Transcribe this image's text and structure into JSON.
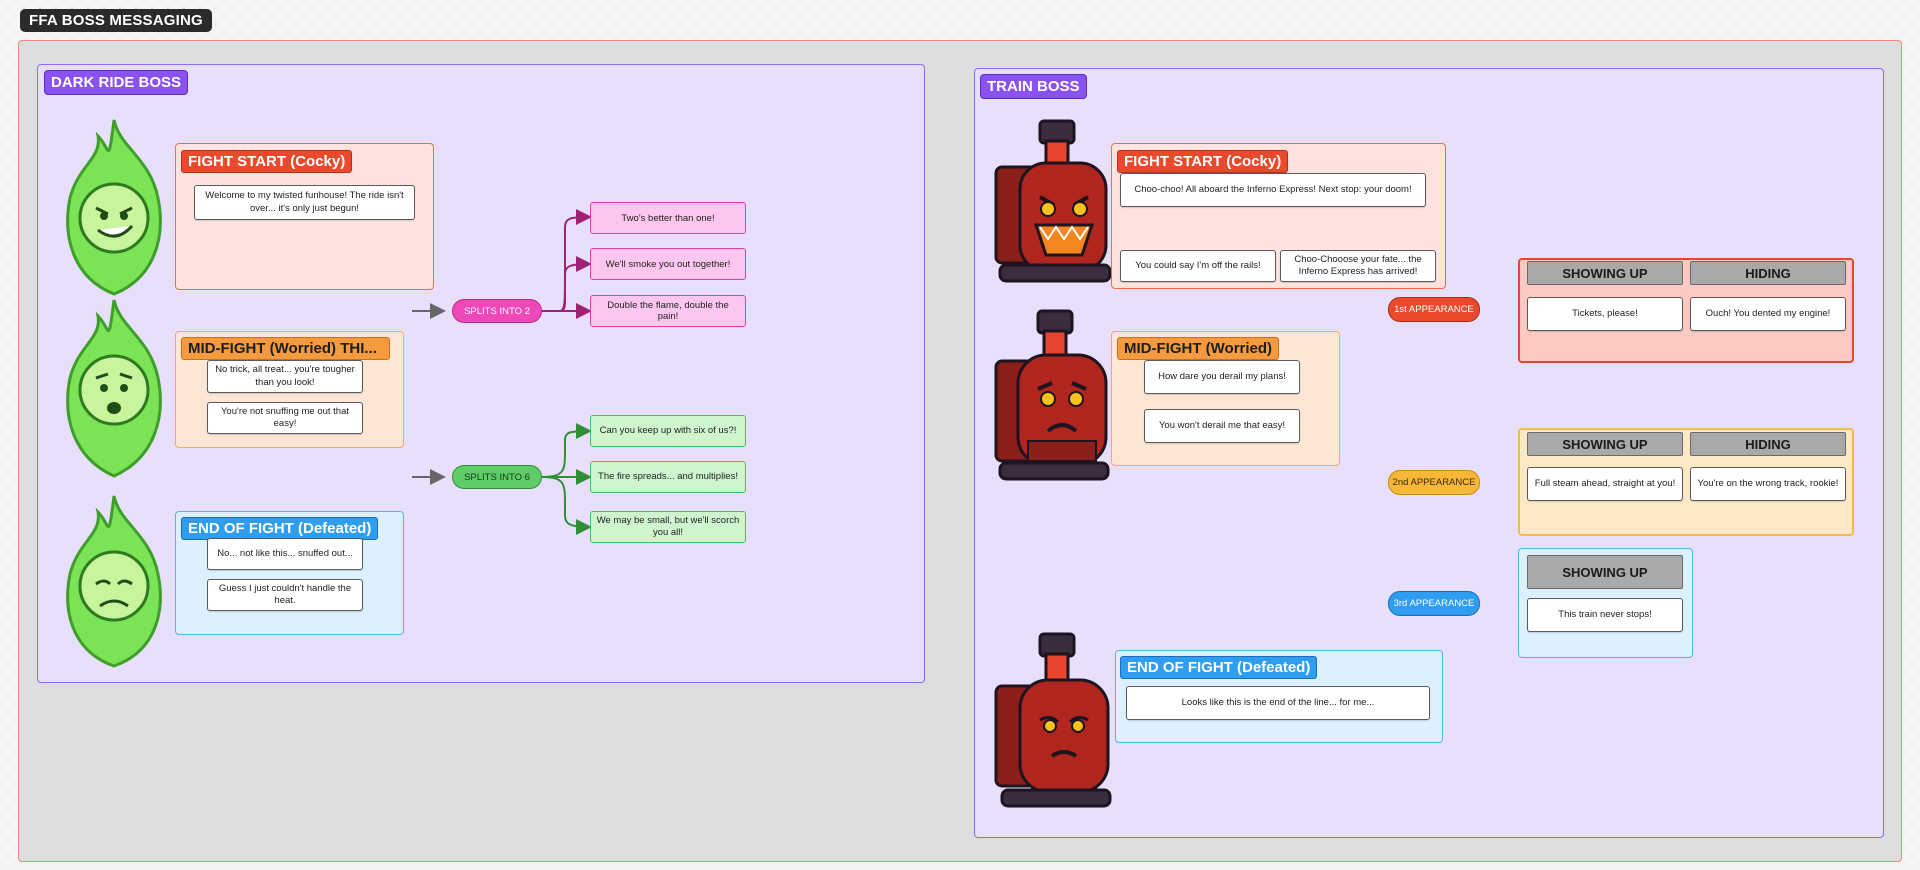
{
  "page_title": "FFA BOSS MESSAGING",
  "dark_ride": {
    "title": "DARK RIDE BOSS",
    "fight_start": {
      "label": "FIGHT START (Cocky)",
      "line1": "Welcome to my twisted funhouse! The ride isn't over... it's only just begun!"
    },
    "mid_fight": {
      "label": "MID-FIGHT (Worried) THI...",
      "line1": "No trick, all treat... you're tougher than you look!",
      "line2": "You're not snuffing me out that easy!"
    },
    "end_fight": {
      "label": "END OF FIGHT (Defeated)",
      "line1": "No... not like this... snuffed out...",
      "line2": "Guess I just couldn't handle the heat."
    },
    "split2": {
      "label": "SPLITS INTO 2",
      "lines": [
        "Two's better than one!",
        "We'll smoke you out together!",
        "Double the flame, double the pain!"
      ]
    },
    "split6": {
      "label": "SPLITS INTO 6",
      "lines": [
        "Can you keep up with six of us?!",
        "The fire spreads... and multiplies!",
        "We may be small, but we'll scorch you all!"
      ]
    }
  },
  "train": {
    "title": "TRAIN BOSS",
    "fight_start": {
      "label": "FIGHT START (Cocky)",
      "line1": "Choo-choo! All aboard the Inferno Express! Next stop: your doom!",
      "line2": "You could say I'm off the rails!",
      "line3": "Choo-Chooose your fate... the Inferno Express has arrived!"
    },
    "mid_fight": {
      "label": "MID-FIGHT (Worried)",
      "line1": "How dare you derail my plans!",
      "line2": "You won't derail me that easy!"
    },
    "end_fight": {
      "label": "END OF FIGHT (Defeated)",
      "line1": "Looks like this is the end of the line... for me..."
    },
    "appearance1": {
      "label": "1st APPEARANCE",
      "showing_hdr": "SHOWING UP",
      "hiding_hdr": "HIDING",
      "showing": "Tickets, please!",
      "hiding": "Ouch! You dented my engine!"
    },
    "appearance2": {
      "label": "2nd APPEARANCE",
      "showing_hdr": "SHOWING UP",
      "hiding_hdr": "HIDING",
      "showing": "Full steam ahead, straight at you!",
      "hiding": "You're on the wrong track, rookie!"
    },
    "appearance3": {
      "label": "3rd APPEARANCE",
      "showing_hdr": "SHOWING UP",
      "showing": "This train never stops!"
    }
  },
  "colors": {
    "flame": "#6be04f",
    "train": "#a8241c",
    "accent_purple": "#8a52f0"
  }
}
